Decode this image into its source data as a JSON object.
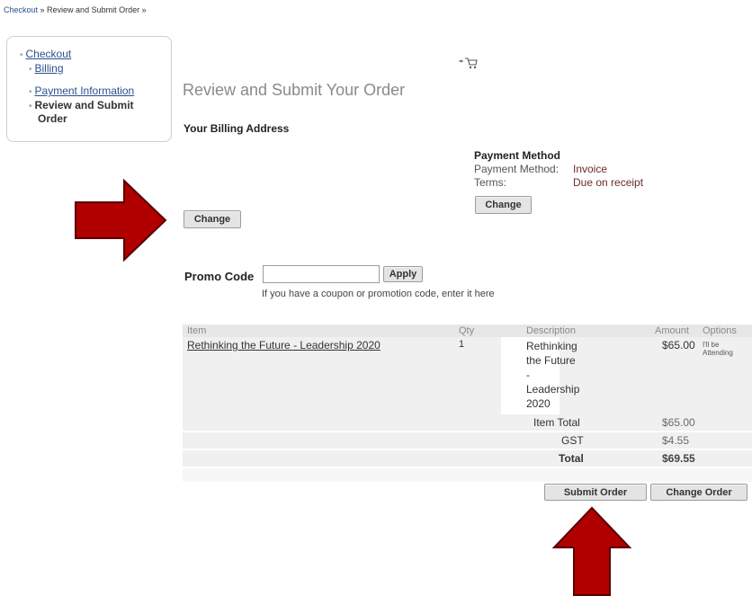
{
  "breadcrumb": {
    "checkout": "Checkout",
    "sep1": " » ",
    "current": "Review and Submit Order",
    "sep2": " »"
  },
  "nav": {
    "checkout": "Checkout",
    "billing": "Billing",
    "payment": "Payment Information",
    "review_line1": "Review and Submit",
    "review_line2": "Order"
  },
  "icons": {
    "cart": "shopping-cart-icon",
    "arrow": "red-arrow-icon"
  },
  "page_title": "Review and Submit Your Order",
  "billing_heading": "Your Billing Address",
  "billing_change": "Change",
  "payment": {
    "heading": "Payment Method",
    "method_label": "Payment Method:",
    "method_value": "Invoice",
    "terms_label": "Terms:",
    "terms_value": "Due on receipt",
    "change": "Change"
  },
  "promo": {
    "label": "Promo Code",
    "value": "",
    "apply": "Apply",
    "hint": "If you have a coupon or promotion code, enter it here"
  },
  "table": {
    "headers": [
      "Item",
      "Qty",
      "Description",
      "Amount",
      "Options"
    ],
    "row": {
      "item": "Rethinking the Future - Leadership 2020",
      "qty": "1",
      "desc_lines": [
        "Rethinking",
        "the Future",
        "-",
        "Leadership",
        "2020"
      ],
      "amount": "$65.00",
      "options_lines": [
        "I'll be",
        "Attending"
      ]
    },
    "item_total_label": "Item Total",
    "item_total": "$65.00",
    "gst_label": "GST",
    "gst": "$4.55",
    "total_label": "Total",
    "total": "$69.55"
  },
  "buttons": {
    "submit": "Submit Order",
    "change_order": "Change Order"
  },
  "colors": {
    "arrow": "#b00000",
    "link": "#2b4f8f",
    "header_bg": "#e7e7e7",
    "row_bg": "#f0f0f0"
  }
}
